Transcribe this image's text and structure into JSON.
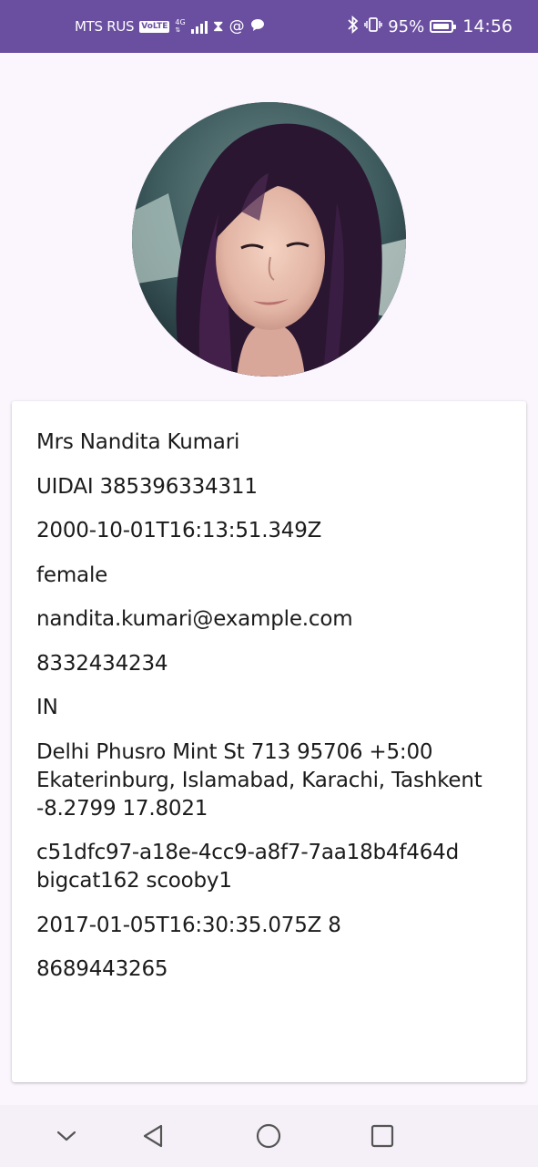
{
  "status_bar": {
    "carrier": "MTS RUS",
    "volte": "VoLTE",
    "network": "4G",
    "battery": "95%",
    "battery_level": 0.95,
    "time": "14:56",
    "background": "#6a4ea0"
  },
  "profile": {
    "photo_icon": "person-photo"
  },
  "details": {
    "name": "Mrs Nandita Kumari",
    "id": "UIDAI 385396334311",
    "dob": "2000-10-01T16:13:51.349Z",
    "gender": "female",
    "email": "nandita.kumari@example.com",
    "phone": "8332434234",
    "nat": "IN",
    "location": "Delhi Phusro Mint St 713 95706 +5:00 Ekaterinburg, Islamabad, Karachi, Tashkent -8.2799 17.8021",
    "login": "c51dfc97-a18e-4cc9-a8f7-7aa18b4f464d bigcat162 scooby1",
    "registered": "2017-01-05T16:30:35.075Z 8",
    "cell": "8689443265"
  },
  "nav": {
    "collapse_icon": "chevron-down-icon",
    "back_icon": "back-triangle-icon",
    "home_icon": "home-circle-icon",
    "recents_icon": "recents-square-icon"
  }
}
